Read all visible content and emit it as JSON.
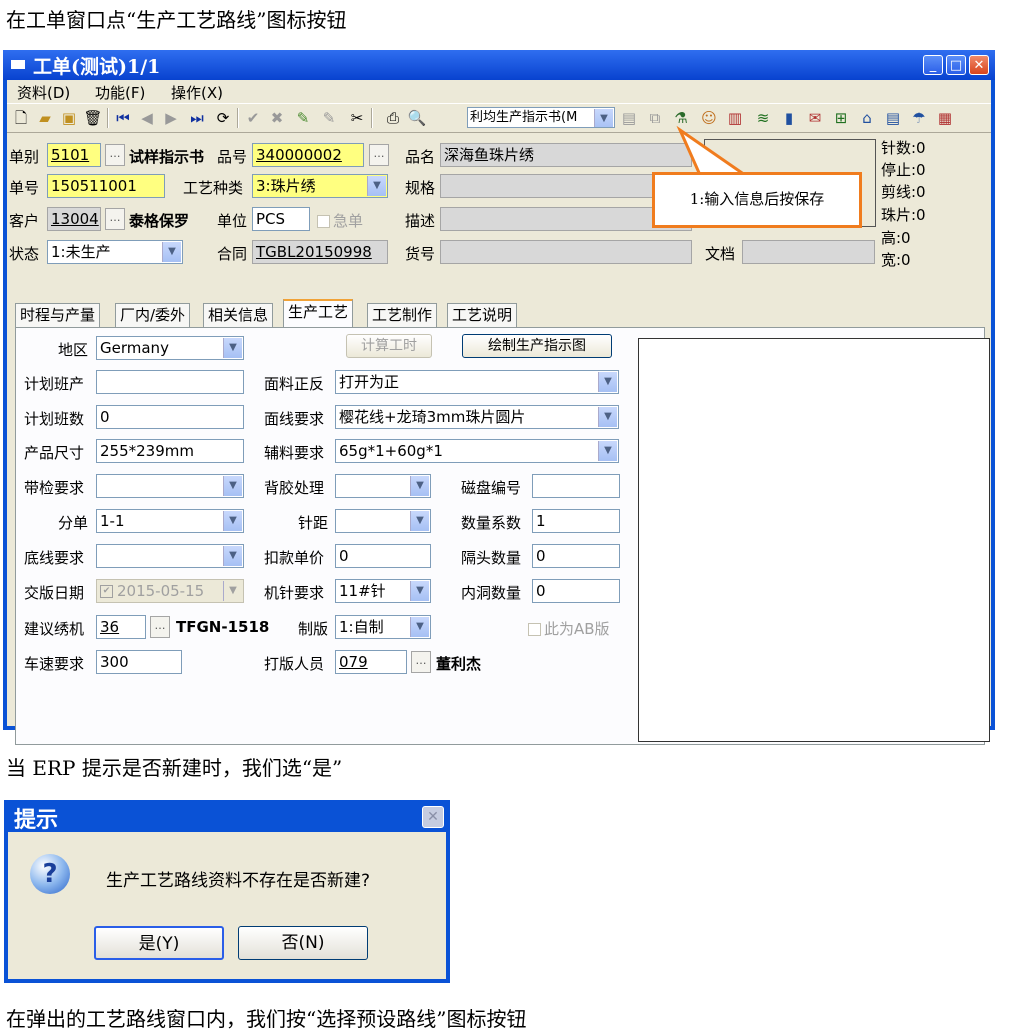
{
  "captions": {
    "step1": "在工单窗口点“生产工艺路线”图标按钮",
    "step2": "当 ERP 提示是否新建时，我们选“是”",
    "step3": "在弹出的工艺路线窗口内，我们按“选择预设路线”图标按钮"
  },
  "window": {
    "title": "工单(测试)1/1",
    "controls": {
      "minimize": "_",
      "maximize": "□",
      "close": "✕"
    }
  },
  "menu": [
    "资料(D)",
    "功能(F)",
    "操作(X)"
  ],
  "toolbar": {
    "print_template": "利均生产指示书(M",
    "icons": [
      "new-icon",
      "open-icon",
      "save-icon",
      "delete-icon",
      "first-icon",
      "prev-icon",
      "next-icon",
      "last-icon",
      "refresh-icon",
      "confirm-icon",
      "cancel-icon",
      "approve-icon",
      "unapprove-icon",
      "tools-icon",
      "print-icon",
      "preview-icon",
      "grid-icon",
      "copy-icon",
      "process-route-icon",
      "user-icon",
      "chart-icon",
      "wireless-icon",
      "device-icon",
      "mail-icon",
      "tree-icon",
      "home-icon",
      "document-icon",
      "umbrella-icon",
      "exit-icon"
    ]
  },
  "header": {
    "type_label": "单别",
    "type_value": "5101",
    "type_name": "试样指示书",
    "product_no_label": "品号",
    "product_no_value": "340000002",
    "product_name_label": "品名",
    "product_name_value": "深海鱼珠片绣",
    "order_no_label": "单号",
    "order_no_value": "150511001",
    "process_type_label": "工艺种类",
    "process_type_value": "3:珠片绣",
    "spec_label": "规格",
    "spec_value": "",
    "customer_label": "客户",
    "customer_value": "13004",
    "customer_name": "泰格保罗",
    "unit_label": "单位",
    "unit_value": "PCS",
    "urgent_label": "急单",
    "desc_label": "描述",
    "desc_value": "",
    "status_label": "状态",
    "status_value": "1:未生产",
    "contract_label": "合同",
    "contract_value": "TGBL20150998",
    "goods_no_label": "货号",
    "goods_no_value": "",
    "doc_label": "文档",
    "doc_value": ""
  },
  "stats": [
    "针数:0",
    "停止:0",
    "剪线:0",
    "珠片:0",
    "高:0",
    "宽:0"
  ],
  "callout": "1:输入信息后按保存",
  "tabs": [
    "时程与产量",
    "厂内/委外",
    "相关信息",
    "生产工艺",
    "工艺制作",
    "工艺说明"
  ],
  "active_tab": 3,
  "form": {
    "region_label": "地区",
    "region_value": "Germany",
    "calc_time_button": "计算工时",
    "draw_button": "绘制生产指示图",
    "plan_shift_label": "计划班产",
    "plan_shift_value": "",
    "fabric_label": "面料正反",
    "fabric_value": "打开为正",
    "plan_count_label": "计划班数",
    "plan_count_value": "0",
    "thread_label": "面线要求",
    "thread_value": "樱花线+龙琦3mm珠片圆片",
    "size_label": "产品尺寸",
    "size_value": "255*239mm",
    "aux_label": "辅料要求",
    "aux_value": "65g*1+60g*1",
    "band_label": "带检要求",
    "band_value": "",
    "backing_label": "背胶处理",
    "backing_value": "",
    "disk_label": "磁盘编号",
    "disk_value": "",
    "split_label": "分单",
    "split_value": "1-1",
    "stitch_label": "针距",
    "stitch_value": "",
    "qty_coef_label": "数量系数",
    "qty_coef_value": "1",
    "bottom_label": "底线要求",
    "bottom_value": "",
    "deduct_label": "扣款单价",
    "deduct_value": "0",
    "gap_label": "隔头数量",
    "gap_value": "0",
    "delivery_label": "交版日期",
    "delivery_value": "2015-05-15",
    "needle_label": "机针要求",
    "needle_value": "11#针",
    "hole_label": "内洞数量",
    "hole_value": "0",
    "machine_label": "建议绣机",
    "machine_value": "36",
    "machine_name": "TFGN-1518",
    "plate_label": "制版",
    "plate_value": "1:自制",
    "ab_label": "此为AB版",
    "speed_label": "车速要求",
    "speed_value": "300",
    "maker_label": "打版人员",
    "maker_value": "079",
    "maker_name": "董利杰"
  },
  "dialog": {
    "title": "提示",
    "message": "生产工艺路线资料不存在是否新建?",
    "yes": "是(Y)",
    "no": "否(N)"
  },
  "colors": {
    "titlebar": "#0a52d6",
    "highlight": "#ffff80",
    "callout_border": "#f07c1e",
    "window_bg": "#ece9d8"
  }
}
